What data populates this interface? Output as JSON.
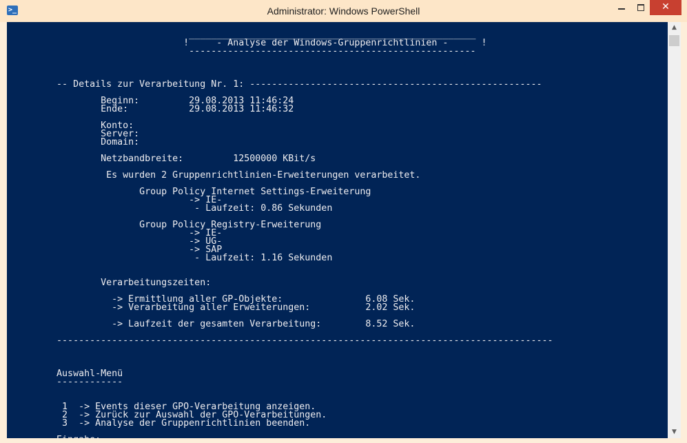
{
  "window": {
    "title": "Administrator: Windows PowerShell",
    "icon": "powershell-icon",
    "close_glyph": "✕",
    "accent": "#012456"
  },
  "scrollbar": {
    "up_glyph": "▲",
    "down_glyph": "▼"
  },
  "console": {
    "lines": [
      "",
      "                                 ____________________________________________________",
      "                                !     - Analyse der Windows-Gruppenrichtlinien -      !",
      "                                 ----------------------------------------------------",
      "",
      "",
      "",
      "         -- Details zur Verarbeitung Nr. 1: -----------------------------------------------------",
      "",
      "                 Beginn:         29.08.2013 11:46:24",
      "                 Ende:           29.08.2013 11:46:32",
      "",
      "                 Konto:",
      "                 Server:",
      "                 Domain:",
      "",
      "                 Netzbandbreite:         12500000 KBit/s",
      "",
      "                  Es wurden 2 Gruppenrichtlinien-Erweiterungen verarbeitet.",
      "",
      "                        Group Policy Internet Settings-Erweiterung",
      "                                 -> IE-",
      "                                  - Laufzeit: 0.86 Sekunden",
      "",
      "                        Group Policy Registry-Erweiterung",
      "                                 -> IE-",
      "                                 -> UG-",
      "                                 -> SAP",
      "                                  - Laufzeit: 1.16 Sekunden",
      "",
      "",
      "                 Verarbeitungszeiten:",
      "",
      "                   -> Ermittlung aller GP-Objekte:               6.08 Sek.",
      "                   -> Verarbeitung aller Erweiterungen:          2.02 Sek.",
      "",
      "                   -> Laufzeit der gesamten Verarbeitung:        8.52 Sek.",
      "",
      "         ------------------------------------------------------------------------------------------",
      "",
      "",
      "",
      "         Auswahl-Menü",
      "         ------------",
      "",
      "",
      "          1  -> Events dieser GPO-Verarbeitung anzeigen.",
      "          2  -> Zurück zur Auswahl der GPO-Verarbeitungen.",
      "          3  -> Analyse der Gruppenrichtlinien beenden.",
      "",
      "         Eingabe: "
    ]
  }
}
